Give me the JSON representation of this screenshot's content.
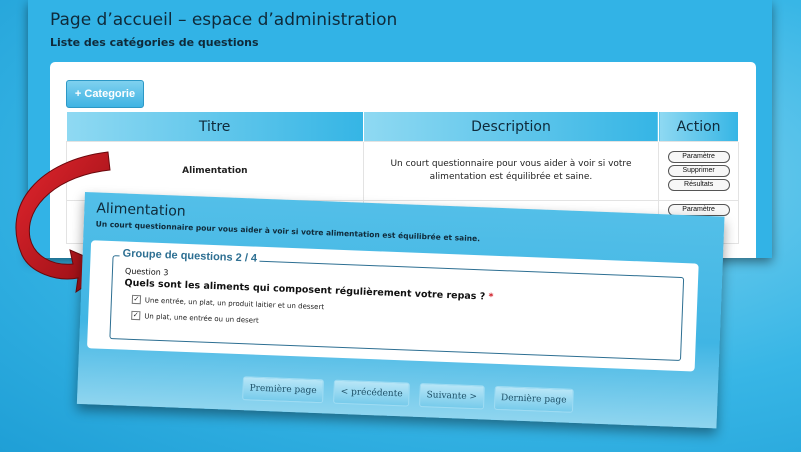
{
  "admin": {
    "title": "Page d’accueil – espace d’administration",
    "subtitle": "Liste des catégories de questions",
    "add_button": "+ Categorie",
    "columns": [
      "Titre",
      "Description",
      "Action"
    ],
    "rows": [
      {
        "title": "Alimentation",
        "description": "Un court questionnaire pour vous aider à voir si votre alimentation est équilibrée et saine.",
        "actions": [
          "Paramètre",
          "Supprimer",
          "Résultats"
        ]
      },
      {
        "title": "",
        "description": "",
        "actions": [
          "Paramètre"
        ]
      }
    ]
  },
  "quiz": {
    "title": "Alimentation",
    "description": "Un court questionnaire pour vous aider à voir si votre alimentation est équilibrée et saine.",
    "group_label": "Groupe de questions 2 / 4",
    "question_number": "Question 3",
    "question_text": "Quels sont les aliments qui composent régulièrement votre repas ?",
    "required_mark": "*",
    "options": [
      {
        "label": "Une entrée, un plat, un produit laitier et un dessert",
        "checked": true
      },
      {
        "label": "Un plat, une entrée ou un desert",
        "checked": true
      }
    ],
    "nav": {
      "first": "Première page",
      "prev": "< précédente",
      "next": "Suivante >",
      "last": "Dernière page"
    }
  },
  "colors": {
    "background": "#38b6e6",
    "arrow": "#c0141c",
    "accent": "#2d6f92"
  },
  "icons": [
    "curved-arrow-icon",
    "checkbox-checked-icon"
  ]
}
